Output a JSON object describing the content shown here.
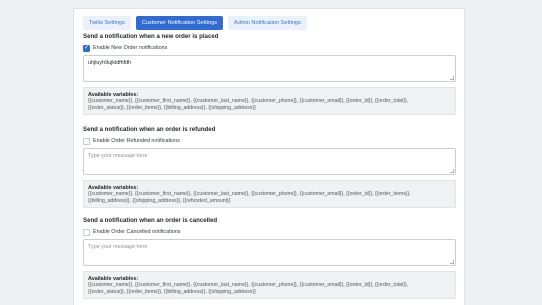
{
  "tabs": [
    {
      "label": "Twilio Settings",
      "active": false
    },
    {
      "label": "Customer Notification Settings",
      "active": true
    },
    {
      "label": "Admin Notification Settings",
      "active": false
    }
  ],
  "sections": [
    {
      "title": "Send a notification when a new order is placed",
      "checkbox_label": "Enable New Order notifications",
      "checked": true,
      "message_value": "uhjluyh9ujkldfhfdh",
      "message_placeholder": "",
      "variables_title": "Available variables:",
      "variables_line1": "{{customer_name}}, {{customer_first_name}}, {{customer_last_name}}, {{customer_phone}}, {{customer_email}}, {{order_id}}, {{order_total}},",
      "variables_line2": "{{order_status}}, {{order_items}}, {{billing_address}}, {{shipping_address}}"
    },
    {
      "title": "Send a notification when an order is refunded",
      "checkbox_label": "Enable Order Refunded notifications",
      "checked": false,
      "message_value": "",
      "message_placeholder": "Type your message here",
      "variables_title": "Available variables:",
      "variables_line1": "{{customer_name}}, {{customer_first_name}}, {{customer_last_name}}, {{customer_phone}}, {{customer_email}}, {{order_id}}, {{order_items}},",
      "variables_line2": "{{billing_address}}, {{shipping_address}}, {{refunded_amount}}"
    },
    {
      "title": "Send a notification when an order is cancelled",
      "checkbox_label": "Enable Order Cancelled notifications",
      "checked": false,
      "message_value": "",
      "message_placeholder": "Type your message here",
      "variables_title": "Available variables:",
      "variables_line1": "{{customer_name}}, {{customer_first_name}}, {{customer_last_name}}, {{customer_phone}}, {{customer_email}}, {{order_id}}, {{order_total}},",
      "variables_line2": "{{order_status}}, {{order_items}}, {{billing_address}}, {{shipping_address}}"
    }
  ],
  "colors": {
    "accent": "#2f6bd0",
    "tab_inactive_bg": "#eaf1fb",
    "tab_inactive_text": "#3d74c9",
    "page_bg": "#eef1f4",
    "variables_bg": "#f0f1f3"
  },
  "icons": {
    "checkbox_checked": "checkmark-icon",
    "textarea_resize": "resize-grip-icon"
  }
}
